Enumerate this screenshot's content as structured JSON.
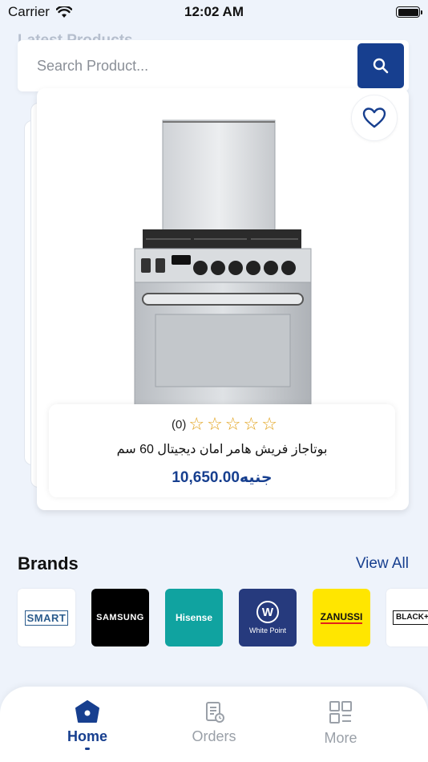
{
  "status_bar": {
    "carrier": "Carrier",
    "time": "12:02 AM"
  },
  "section_header": "Latest Products",
  "search": {
    "placeholder": "Search Product..."
  },
  "product": {
    "rating_stars": 0,
    "rating_count": "(0)",
    "name": "بوتاجاز فريش هامر امان ديجيتال 60 سم",
    "price": "جنيه10,650.00"
  },
  "brands": {
    "title": "Brands",
    "view_all": "View All",
    "items": [
      {
        "name": "SMART",
        "label": "SMART",
        "bg": "#ffffff",
        "fg": "#2b5b8c"
      },
      {
        "name": "Samsung",
        "label": "SAMSUNG",
        "bg": "#000000",
        "fg": "#ffffff"
      },
      {
        "name": "Hisense",
        "label": "Hisense",
        "bg": "#10a3a0",
        "fg": "#ffffff"
      },
      {
        "name": "White Point",
        "label": "White Point",
        "bg": "#263a7d",
        "fg": "#ffffff"
      },
      {
        "name": "Zanussi",
        "label": "ZANUSSI",
        "bg": "#ffe600",
        "fg": "#111111"
      },
      {
        "name": "Black+Decker",
        "label": "BLACK+DECKER",
        "bg": "#ffffff",
        "fg": "#111111"
      }
    ]
  },
  "nav": {
    "items": [
      {
        "label": "Home",
        "icon": "home-icon",
        "active": true
      },
      {
        "label": "Orders",
        "icon": "orders-icon",
        "active": false
      },
      {
        "label": "More",
        "icon": "more-grid-icon",
        "active": false
      }
    ]
  },
  "colors": {
    "primary": "#173f8f",
    "star": "#e2a21a",
    "background": "#eef3fb"
  }
}
